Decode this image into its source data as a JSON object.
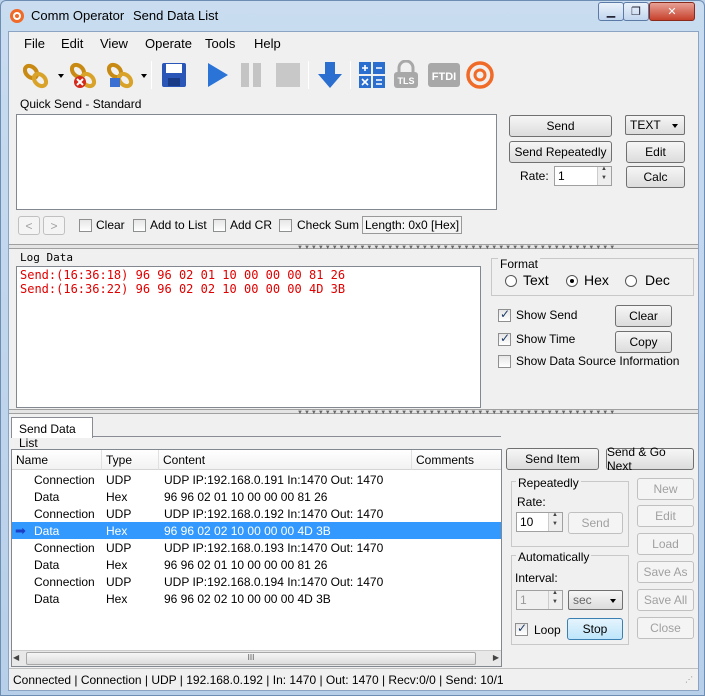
{
  "window": {
    "app_title": "Comm Operator",
    "doc_title": "Send Data List",
    "minimize": "▁",
    "restore": "❐",
    "close": "✕"
  },
  "menu": [
    "File",
    "Edit",
    "View",
    "Operate",
    "Tools",
    "Help"
  ],
  "toolbar": {
    "icons": [
      "connect-chain-icon",
      "disconnect-chain-icon",
      "connection-settings-icon",
      "save-icon",
      "play-icon",
      "pause-icon",
      "stop-icon",
      "download-arrow-icon",
      "calculator-icon",
      "tls-icon",
      "ftdi-icon",
      "app-logo-icon"
    ],
    "tls_label": "TLS",
    "ftdi_label": "FTDI"
  },
  "quick_send": {
    "title": "Quick Send - Standard",
    "input_value": "",
    "send": "Send",
    "send_repeatedly": "Send Repeatedly",
    "rate_label": "Rate:",
    "rate_value": "1",
    "mode": "TEXT",
    "edit": "Edit",
    "calc": "Calc",
    "prev": "<",
    "next": ">",
    "clear": "Clear",
    "add_to_list": "Add to List",
    "add_cr": "Add CR",
    "check_sum": "Check Sum",
    "length": "Length: 0x0 [Hex]"
  },
  "log": {
    "title": "Log Data",
    "lines": [
      "Send:(16:36:18) 96 96 02 01 10 00 00 00 81 26",
      "Send:(16:36:22) 96 96 02 02 10 00 00 00 4D 3B"
    ]
  },
  "format": {
    "title": "Format",
    "text": "Text",
    "hex": "Hex",
    "dec": "Dec",
    "selected": "Hex",
    "show_send": "Show Send",
    "show_time": "Show Time",
    "show_source": "Show Data Source Information",
    "clear": "Clear",
    "copy": "Copy"
  },
  "tab": {
    "label": "Send Data List"
  },
  "list": {
    "headers": [
      "Name",
      "Type",
      "Content",
      "Comments"
    ],
    "rows": [
      {
        "name": "Connection",
        "type": "UDP",
        "content": "UDP IP:192.168.0.191 In:1470 Out: 1470",
        "comments": ""
      },
      {
        "name": "Data",
        "type": "Hex",
        "content": "96 96 02 01 10 00 00 00 81 26",
        "comments": ""
      },
      {
        "name": "Connection",
        "type": "UDP",
        "content": "UDP IP:192.168.0.192 In:1470 Out: 1470",
        "comments": ""
      },
      {
        "name": "Data",
        "type": "Hex",
        "content": "96 96 02 02 10 00 00 00 4D 3B",
        "comments": ""
      },
      {
        "name": "Connection",
        "type": "UDP",
        "content": "UDP IP:192.168.0.193 In:1470 Out: 1470",
        "comments": ""
      },
      {
        "name": "Data",
        "type": "Hex",
        "content": "96 96 02 01 10 00 00 00 81 26",
        "comments": ""
      },
      {
        "name": "Connection",
        "type": "UDP",
        "content": "UDP IP:192.168.0.194 In:1470 Out: 1470",
        "comments": ""
      },
      {
        "name": "Data",
        "type": "Hex",
        "content": "96 96 02 02 10 00 00 00 4D 3B",
        "comments": ""
      }
    ],
    "selected_index": 3,
    "scroll_grip": "III"
  },
  "side": {
    "send_item": "Send Item",
    "send_go_next": "Send & Go Next",
    "repeatedly": "Repeatedly",
    "rate_label": "Rate:",
    "rate_value": "10",
    "send": "Send",
    "automatically": "Automatically",
    "interval_label": "Interval:",
    "interval_value": "1",
    "interval_unit": "sec",
    "loop": "Loop",
    "stop": "Stop",
    "new": "New",
    "edit": "Edit",
    "load": "Load",
    "save_as": "Save As",
    "save_all": "Save All",
    "close": "Close"
  },
  "status": {
    "text": "Connected | Connection  | UDP | 192.168.0.192 | In: 1470 | Out:  1470 | Recv:0/0 | Send: 10/1"
  }
}
